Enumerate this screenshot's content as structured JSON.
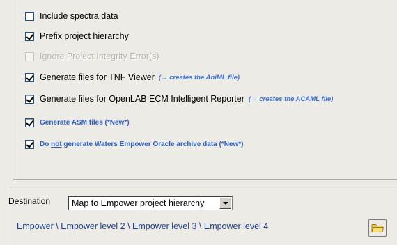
{
  "options": [
    {
      "label": "Include spectra data",
      "checked": false,
      "enabled": true
    },
    {
      "label": "Prefix project hierarchy",
      "checked": true,
      "enabled": true
    },
    {
      "label": "Ignore Project Integrity Error(s)",
      "checked": false,
      "enabled": false
    },
    {
      "label": "Generate files for TNF Viewer",
      "note": "(→ creates the AniML file)",
      "checked": true,
      "enabled": true
    },
    {
      "label": "Generate files for OpenLAB ECM Intelligent Reporter",
      "note": "(→ creates the ACAML file)",
      "checked": true,
      "enabled": true
    },
    {
      "label": "Generate ASM files (*New*)",
      "checked": true,
      "enabled": true
    },
    {
      "label_pre": "Do ",
      "label_underlined": "not",
      "label_post": " generate Waters Empower Oracle archive data (*New*)",
      "checked": true,
      "enabled": true
    }
  ],
  "destination": {
    "label": "Destination",
    "selected": "Map to Empower project hierarchy",
    "path": "Empower \\ Empower level 2 \\ Empower level 3 \\ Empower level 4"
  },
  "icons": {
    "dropdown_arrow": "chevron-down-icon",
    "browse": "folder-icon"
  },
  "colors": {
    "panel_bg": "#ecebe6",
    "note_blue": "#3a6fd8",
    "blue_label": "#2d5dc4",
    "path_text": "#1f3f8a",
    "folder_yellow": "#f2c94c"
  }
}
